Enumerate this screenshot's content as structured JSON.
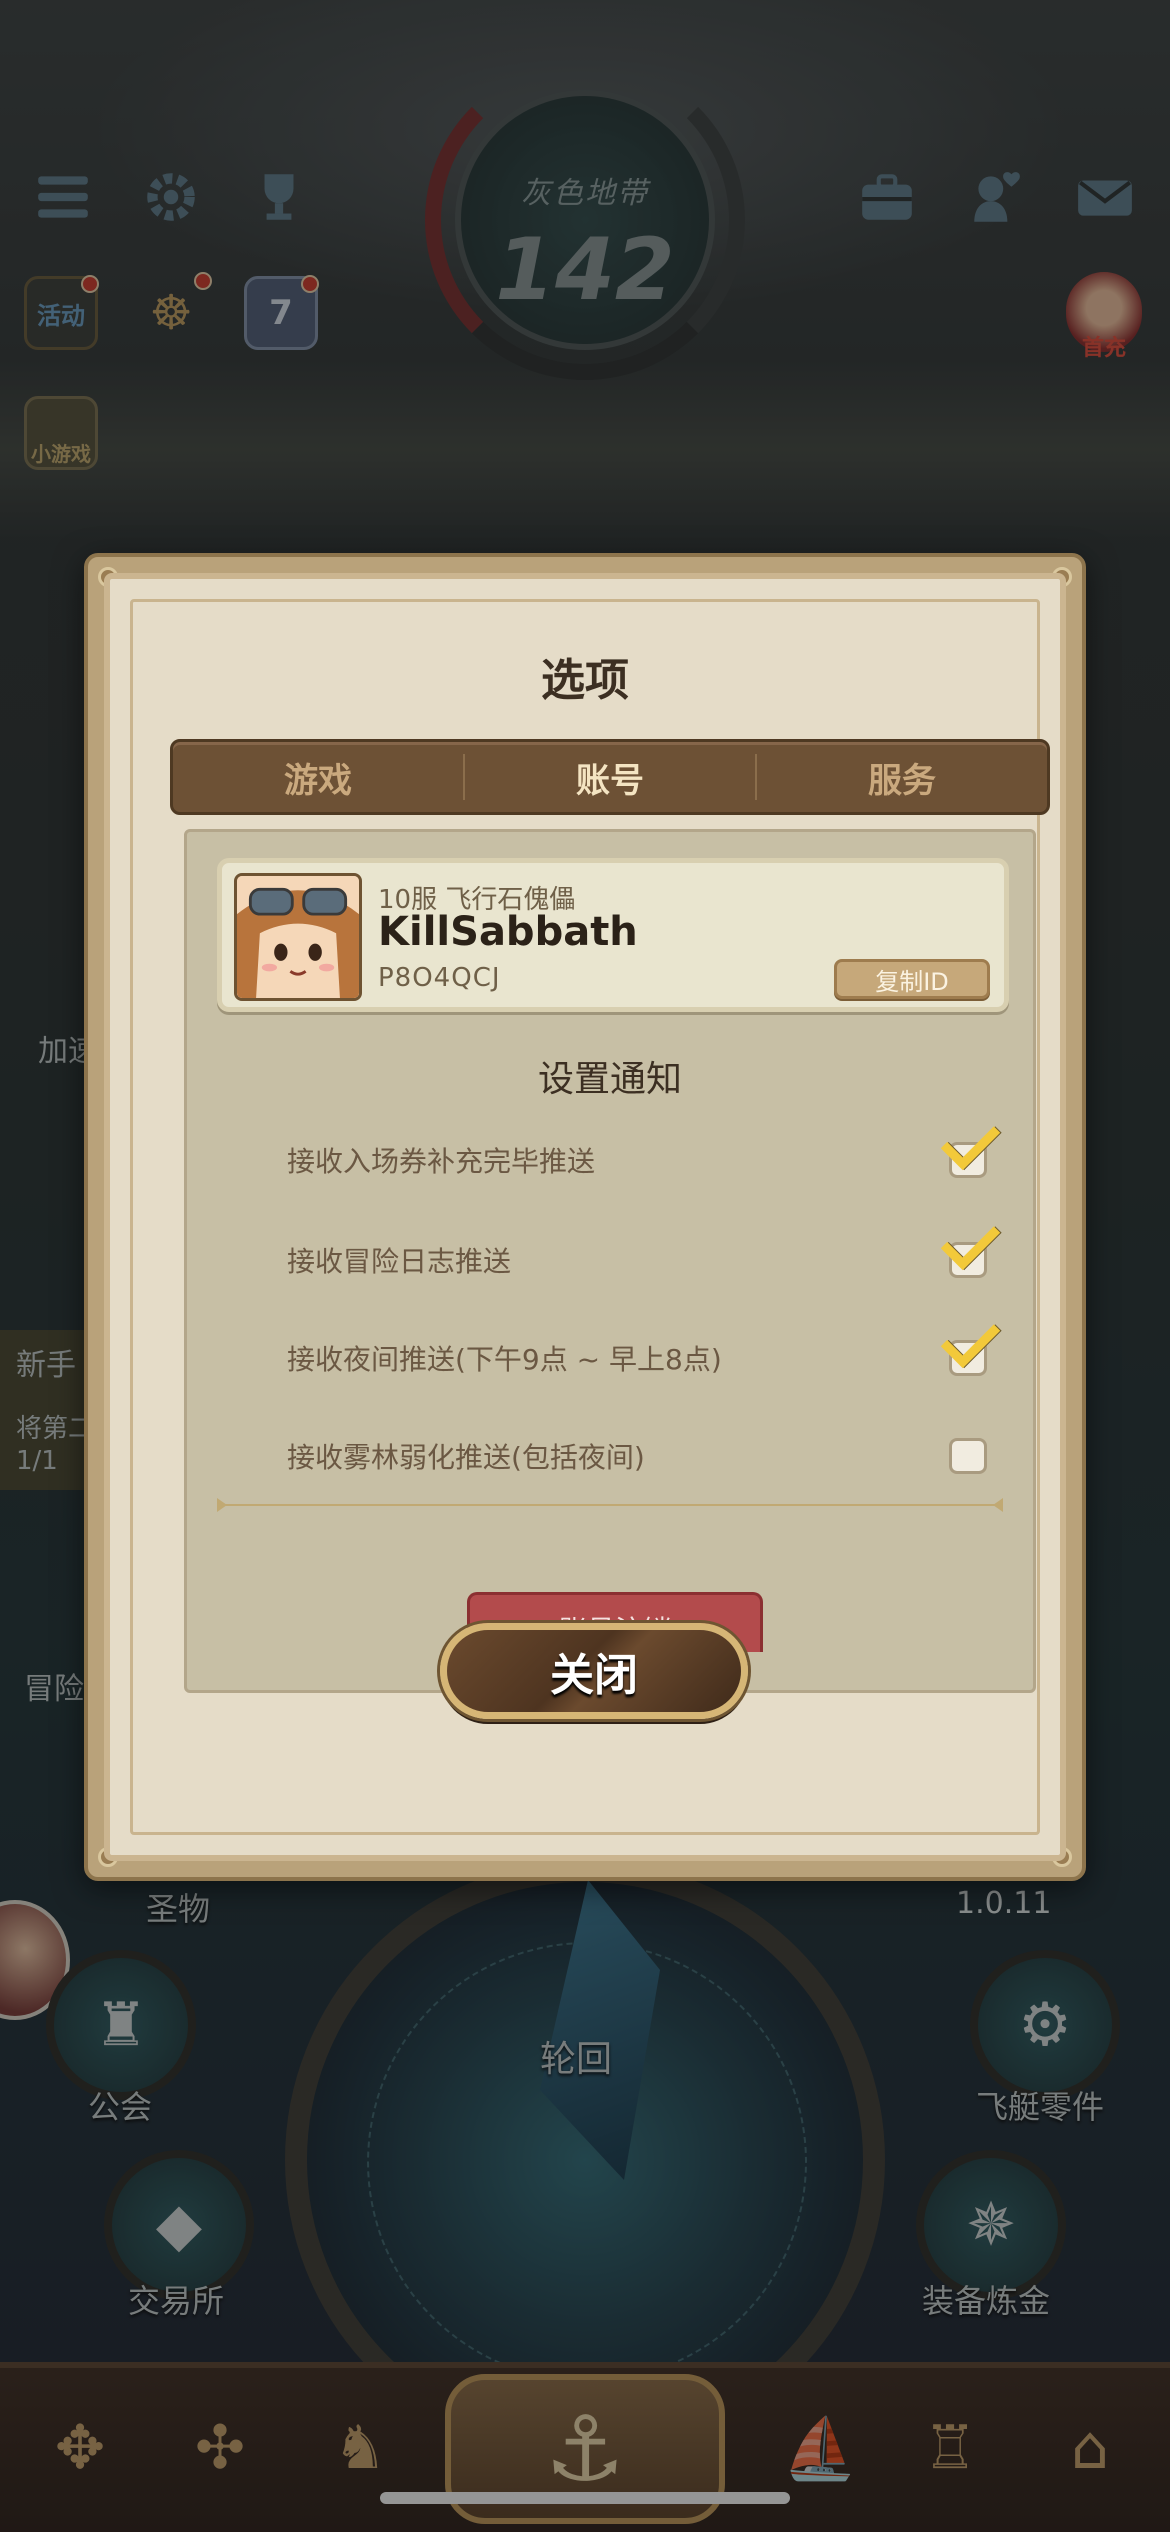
{
  "hud": {
    "zone_title": "灰色地带",
    "level": "142",
    "activity_label": "活动",
    "calendar_day": "7",
    "mini_game_label": "小游戏",
    "first_charge_label": "首充"
  },
  "side": {
    "left_labels": [
      "加速",
      "新手",
      "将第二",
      "1/1",
      "冒险"
    ]
  },
  "dock": {
    "relic": "圣物",
    "guild": "公会",
    "cycle": "轮回",
    "trade": "交易所",
    "airship_parts": "飞艇零件",
    "equip_alchemy": "装备炼金",
    "version": "1.0.11"
  },
  "modal": {
    "title": "选项",
    "tabs": [
      {
        "label": "游戏",
        "active": false
      },
      {
        "label": "账号",
        "active": true
      },
      {
        "label": "服务",
        "active": false
      }
    ],
    "profile": {
      "server": "10服 飞行石傀儡",
      "name": "KillSabbath",
      "player_id": "P8O4QCJ",
      "copy_button": "复制ID"
    },
    "notify_title": "设置通知",
    "notifications": [
      {
        "label": "接收入场券补充完毕推送",
        "checked": true
      },
      {
        "label": "接收冒险日志推送",
        "checked": true
      },
      {
        "label": "接收夜间推送(下午9点 ~ 早上8点)",
        "checked": true
      },
      {
        "label": "接收雾林弱化推送(包括夜间)",
        "checked": false
      }
    ],
    "delete_account": "账号注销",
    "close_button": "关闭"
  },
  "colors": {
    "accent_gold": "#d6b676",
    "tab_bar": "#6d5135",
    "danger": "#b34b4c",
    "check": "#f2c93a"
  }
}
